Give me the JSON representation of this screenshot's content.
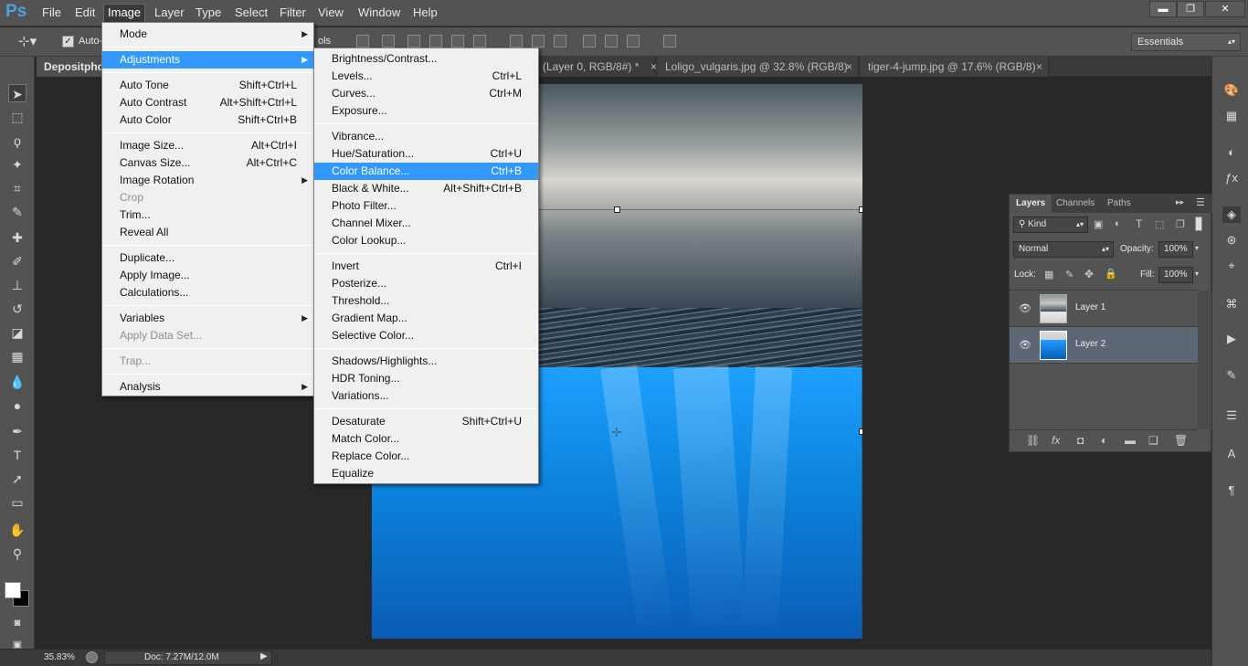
{
  "app": {
    "logo": "Ps"
  },
  "menubar": [
    "File",
    "Edit",
    "Image",
    "Layer",
    "Type",
    "Select",
    "Filter",
    "View",
    "Window",
    "Help"
  ],
  "window_buttons": {
    "minimize": "▬",
    "restore": "❐",
    "close": "✕"
  },
  "options": {
    "auto_label": "Auto-",
    "truncated_label": "ols",
    "workspace": "Essentials"
  },
  "tabs": [
    {
      "label": "Depositpho"
    },
    {
      "label": "(Layer 0, RGB/8#) *"
    },
    {
      "label": "Loligo_vulgaris.jpg @ 32.8% (RGB/8)"
    },
    {
      "label": "tiger-4-jump.jpg @ 17.6% (RGB/8)"
    }
  ],
  "tab_close": "×",
  "image_menu": [
    {
      "label": "Mode",
      "submenu": true
    },
    {
      "sep": true
    },
    {
      "label": "Adjustments",
      "submenu": true,
      "highlighted": true
    },
    {
      "sep": true
    },
    {
      "label": "Auto Tone",
      "shortcut": "Shift+Ctrl+L"
    },
    {
      "label": "Auto Contrast",
      "shortcut": "Alt+Shift+Ctrl+L"
    },
    {
      "label": "Auto Color",
      "shortcut": "Shift+Ctrl+B"
    },
    {
      "sep": true
    },
    {
      "label": "Image Size...",
      "shortcut": "Alt+Ctrl+I"
    },
    {
      "label": "Canvas Size...",
      "shortcut": "Alt+Ctrl+C"
    },
    {
      "label": "Image Rotation",
      "submenu": true
    },
    {
      "label": "Crop",
      "disabled": true
    },
    {
      "label": "Trim..."
    },
    {
      "label": "Reveal All"
    },
    {
      "sep": true
    },
    {
      "label": "Duplicate..."
    },
    {
      "label": "Apply Image..."
    },
    {
      "label": "Calculations..."
    },
    {
      "sep": true
    },
    {
      "label": "Variables",
      "submenu": true
    },
    {
      "label": "Apply Data Set...",
      "disabled": true
    },
    {
      "sep": true
    },
    {
      "label": "Trap...",
      "disabled": true
    },
    {
      "sep": true
    },
    {
      "label": "Analysis",
      "submenu": true
    }
  ],
  "adjustments_menu": [
    {
      "label": "Brightness/Contrast..."
    },
    {
      "label": "Levels...",
      "shortcut": "Ctrl+L"
    },
    {
      "label": "Curves...",
      "shortcut": "Ctrl+M"
    },
    {
      "label": "Exposure..."
    },
    {
      "sep": true
    },
    {
      "label": "Vibrance..."
    },
    {
      "label": "Hue/Saturation...",
      "shortcut": "Ctrl+U"
    },
    {
      "label": "Color Balance...",
      "shortcut": "Ctrl+B",
      "highlighted": true
    },
    {
      "label": "Black & White...",
      "shortcut": "Alt+Shift+Ctrl+B"
    },
    {
      "label": "Photo Filter..."
    },
    {
      "label": "Channel Mixer..."
    },
    {
      "label": "Color Lookup..."
    },
    {
      "sep": true
    },
    {
      "label": "Invert",
      "shortcut": "Ctrl+I"
    },
    {
      "label": "Posterize..."
    },
    {
      "label": "Threshold..."
    },
    {
      "label": "Gradient Map..."
    },
    {
      "label": "Selective Color..."
    },
    {
      "sep": true
    },
    {
      "label": "Shadows/Highlights..."
    },
    {
      "label": "HDR Toning..."
    },
    {
      "label": "Variations..."
    },
    {
      "sep": true
    },
    {
      "label": "Desaturate",
      "shortcut": "Shift+Ctrl+U"
    },
    {
      "label": "Match Color..."
    },
    {
      "label": "Replace Color..."
    },
    {
      "label": "Equalize"
    }
  ],
  "layers_panel": {
    "tabs": [
      "Layers",
      "Channels",
      "Paths"
    ],
    "filter_kind": "Kind",
    "blend_mode": "Normal",
    "opacity_label": "Opacity:",
    "opacity": "100%",
    "lock_label": "Lock:",
    "fill_label": "Fill:",
    "fill": "100%",
    "layers": [
      {
        "name": "Layer 1",
        "selected": false
      },
      {
        "name": "Layer 2",
        "selected": true
      }
    ]
  },
  "status": {
    "zoom": "35.83%",
    "doc": "Doc: 7.27M/12.0M"
  },
  "icons": {
    "tools": [
      "move-icon",
      "marquee-icon",
      "lasso-icon",
      "magic-wand-icon",
      "crop-icon",
      "eyedropper-icon",
      "healing-brush-icon",
      "brush-icon",
      "clone-stamp-icon",
      "history-brush-icon",
      "eraser-icon",
      "gradient-icon",
      "blur-icon",
      "dodge-icon",
      "pen-icon",
      "type-icon",
      "path-selection-icon",
      "rectangle-icon",
      "hand-icon",
      "zoom-icon"
    ],
    "right_column": [
      "color-palette-icon",
      "swatches-icon",
      "adjustments-icon",
      "styles-icon",
      "layers-icon",
      "channels-icon",
      "paths-icon",
      "history-icon",
      "actions-icon",
      "properties-icon",
      "brush-presets-icon",
      "character-icon",
      "paragraph-icon"
    ]
  }
}
